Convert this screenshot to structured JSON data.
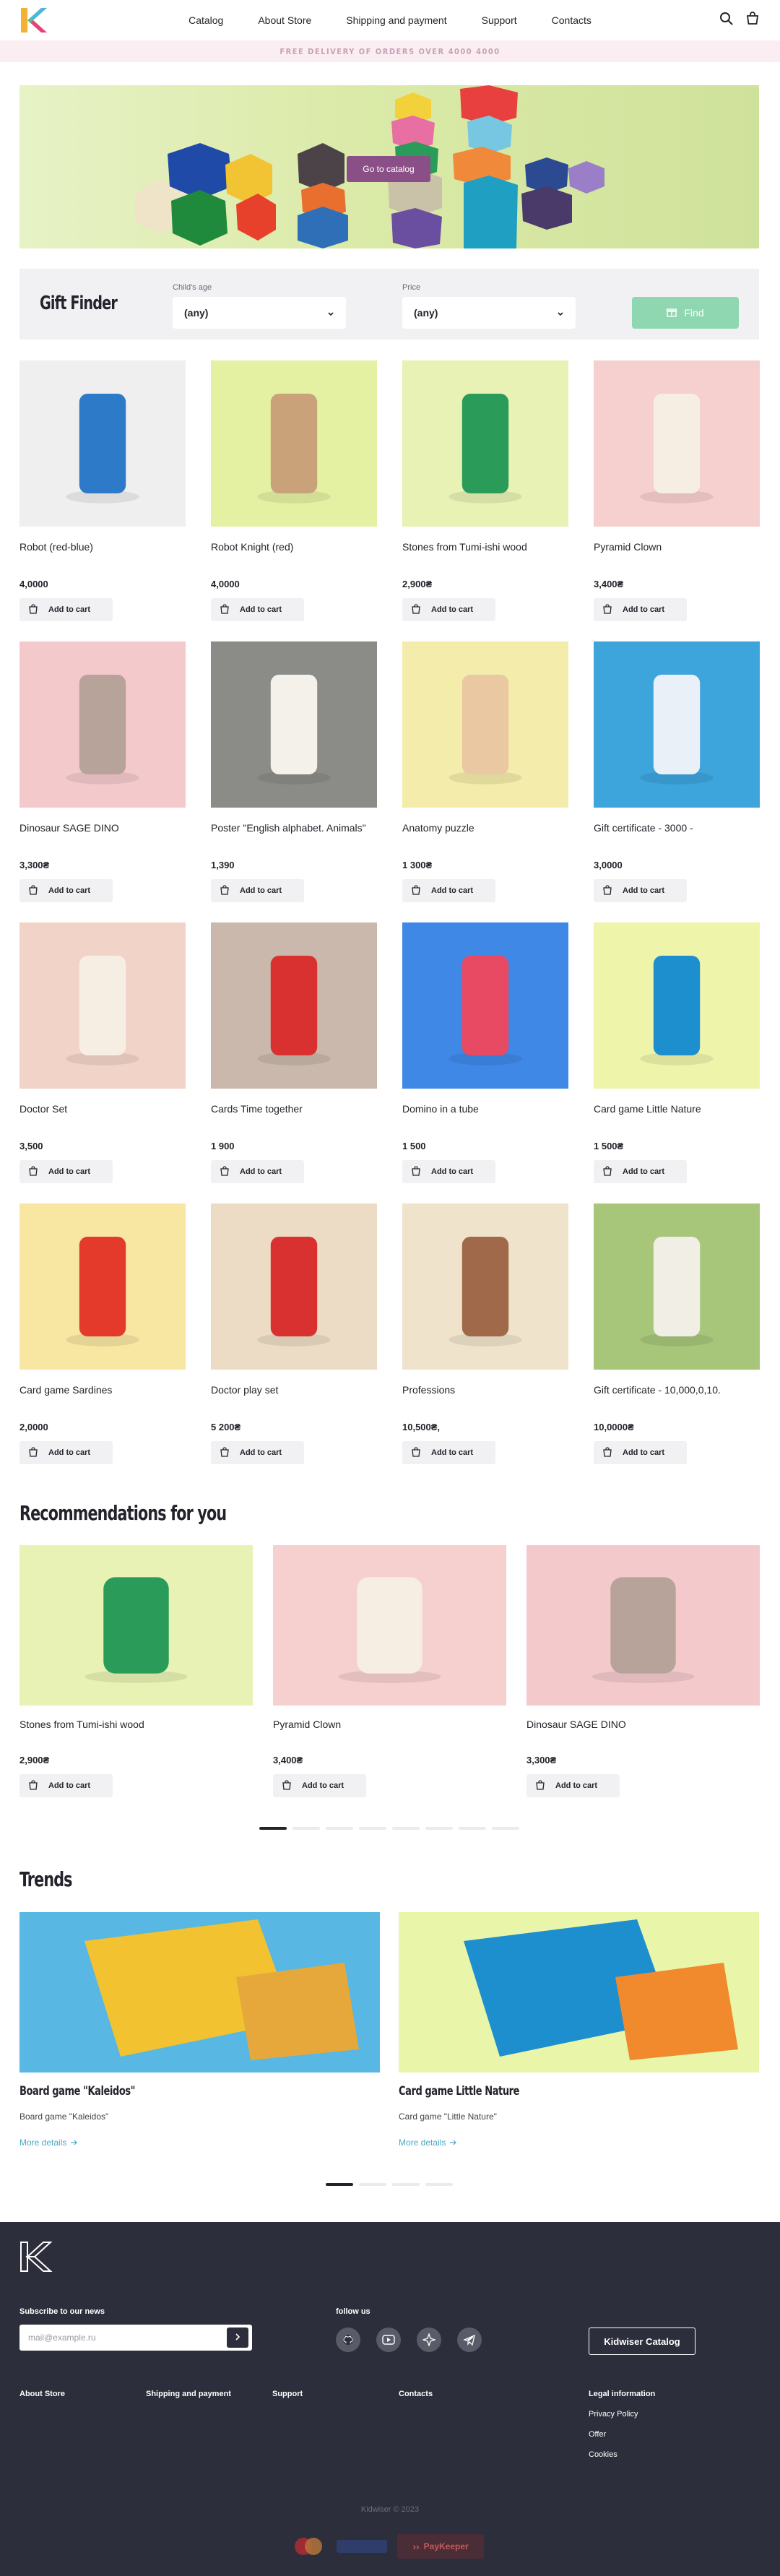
{
  "header": {
    "nav": [
      "Catalog",
      "About Store",
      "Shipping and payment",
      "Support",
      "Contacts"
    ],
    "cart_count": ""
  },
  "promo": {
    "text": "FREE DELIVERY OF ORDERS OVER 4000 4000"
  },
  "hero": {
    "button_label": "Go to catalog"
  },
  "gift_finder": {
    "title": "Gift Finder",
    "age_label": "Child's age",
    "age_value": "(any)",
    "price_label": "Price",
    "price_value": "(any)",
    "find_label": "Find"
  },
  "add_to_cart_label": "Add to cart",
  "products": [
    {
      "title": "Robot (red-blue)",
      "price": "4,0000"
    },
    {
      "title": "Robot Knight (red)",
      "price": "4,0000"
    },
    {
      "title": "Stones from Tumi-ishi wood",
      "price": "2,900₴"
    },
    {
      "title": "Pyramid Clown",
      "price": "3,400₴"
    },
    {
      "title": "Dinosaur SAGE DINO",
      "price": "3,300₴"
    },
    {
      "title": "Poster \"English alphabet. Animals\"",
      "price": "1,390"
    },
    {
      "title": "Anatomy puzzle",
      "price": "1 300₴"
    },
    {
      "title": "Gift certificate - 3000 -",
      "price": "3,0000"
    },
    {
      "title": "Doctor Set",
      "price": "3,500"
    },
    {
      "title": "Cards Time together",
      "price": "1 900"
    },
    {
      "title": "Domino in a tube",
      "price": "1 500"
    },
    {
      "title": "Card game Little Nature",
      "price": "1 500₴"
    },
    {
      "title": "Card game Sardines",
      "price": "2,0000"
    },
    {
      "title": "Doctor play set",
      "price": "5 200₴"
    },
    {
      "title": "Professions",
      "price": "10,500₴,"
    },
    {
      "title": "Gift certificate - 10,000,0,10.",
      "price": "10,0000₴"
    }
  ],
  "recommendations": {
    "title": "Recommendations for you",
    "items": [
      {
        "title": "Stones from Tumi-ishi wood",
        "price": "2,900₴"
      },
      {
        "title": "Pyramid Clown",
        "price": "3,400₴"
      },
      {
        "title": "Dinosaur SAGE DINO",
        "price": "3,300₴"
      }
    ]
  },
  "trends": {
    "title": "Trends",
    "more_label": "More details",
    "items": [
      {
        "title": "Board game \"Kaleidos\"",
        "subtitle": "Board game \"Kaleidos\""
      },
      {
        "title": "Card game Little Nature",
        "subtitle": "Card game \"Little Nature\""
      }
    ]
  },
  "footer": {
    "subscribe_label": "Subscribe to our news",
    "email_placeholder": "mail@example.ru",
    "follow_label": "follow us",
    "catalog_button": "Kidwiser Catalog",
    "links": [
      "About Store",
      "Shipping and payment",
      "Support",
      "Contacts"
    ],
    "legal_title": "Legal information",
    "legal_links": [
      "Privacy Policy",
      "Offer",
      "Cookies"
    ],
    "copyright": "Kidwiser © 2023",
    "payment_text": "PayKeeper"
  },
  "colors": {
    "accent_purple": "#8a4f86",
    "find_green": "#8fd7b0",
    "footer_bg": "#2d2e3b",
    "promo_bg": "#fbeef2",
    "link_blue": "#4aa8c8"
  }
}
